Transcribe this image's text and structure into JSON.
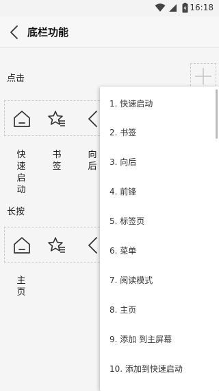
{
  "status_bar": {
    "time": "16:18",
    "icons": [
      "wifi-icon",
      "signal-icon",
      "battery-icon"
    ]
  },
  "app_bar": {
    "title": "底栏功能",
    "back_icon": "chevron-left-icon"
  },
  "tap_section": {
    "label": "点击",
    "add_icon": "plus-icon",
    "slots": [
      {
        "icon": "home-icon",
        "label": "快速启动"
      },
      {
        "icon": "star-list-icon",
        "label": "书签"
      },
      {
        "icon": "chevron-left-icon",
        "label": "向后"
      }
    ]
  },
  "long_press_section": {
    "label": "长按",
    "slots": [
      {
        "icon": "home-icon",
        "label": "主页"
      },
      {
        "icon": "star-list-icon",
        "label": ""
      },
      {
        "icon": "chevron-left-icon",
        "label": ""
      }
    ]
  },
  "menu": {
    "items": [
      "1. 快速启动",
      "2. 书签",
      "3. 向后",
      "4. 前锋",
      "5. 标签页",
      "6. 菜单",
      "7. 阅读模式",
      "8. 主页",
      "9. 添加 到主屏幕",
      "10. 添加到快速启动"
    ]
  }
}
